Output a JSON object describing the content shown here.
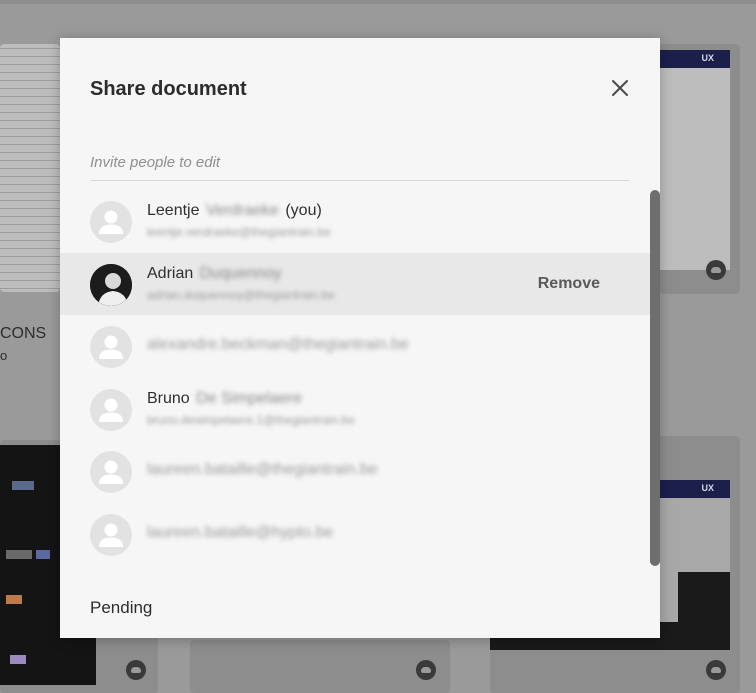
{
  "background": {
    "card_label": "CONS",
    "card_sublabel": "o",
    "thumb_badge": "UX"
  },
  "dialog": {
    "title": "Share document",
    "invite_placeholder": "Invite people to edit",
    "pending_label": "Pending",
    "people": [
      {
        "first": "Leentje",
        "last": "Verdraeke",
        "suffix": "(you)",
        "email": "leentje.verdraeke@thegiantrain.be"
      },
      {
        "first": "Adrian",
        "last": "Duquennoy",
        "email": "adrian.duquennoy@thegiantrain.be",
        "action": "Remove"
      },
      {
        "email": "alexandre.beckman@thegiantrain.be"
      },
      {
        "first": "Bruno",
        "last": "De Simpelaere",
        "email": "bruno.desimpelaere.1@thegiantrain.be"
      },
      {
        "email": "laureen.bataille@thegiantrain.be"
      },
      {
        "email": "laureen.bataille@hypto.be"
      }
    ]
  },
  "icons": {
    "close": "close-icon",
    "avatar_placeholder": "person-icon",
    "cloud": "cloud-icon"
  }
}
